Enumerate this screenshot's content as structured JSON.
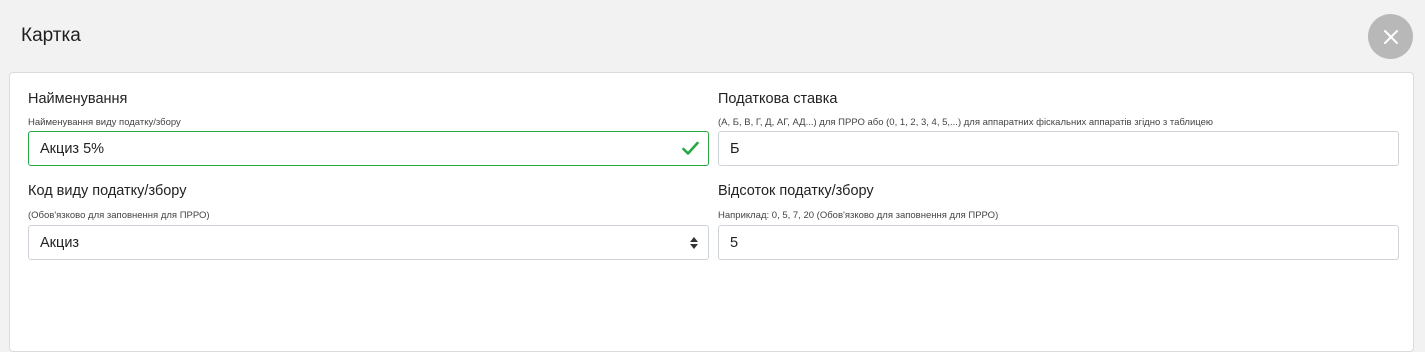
{
  "header": {
    "title": "Картка",
    "close_icon": "close-icon"
  },
  "form": {
    "name": {
      "label": "Найменування",
      "hint": "Найменування виду податку/збору",
      "value": "Акциз 5%",
      "status_icon": "check-icon",
      "status_color": "#28a745"
    },
    "tax_rate": {
      "label": "Податкова ставка",
      "hint": "(А, Б, В, Г, Д, АГ, АД...) для ПРРО або (0, 1, 2, 3, 4, 5,...) для аппаратних фіскальних аппаратів згідно з таблицею",
      "value": "Б"
    },
    "tax_type_code": {
      "label": "Код виду податку/збору",
      "hint": "(Обов'язково для заповнення для ПРРО)",
      "selected": "Акциз",
      "icon": "sort-arrows-icon"
    },
    "tax_percent": {
      "label": "Відсоток податку/збору",
      "hint": "Наприклад: 0, 5, 7, 20 (Обов'язково для заповнення для ПРРО)",
      "value": "5"
    }
  }
}
